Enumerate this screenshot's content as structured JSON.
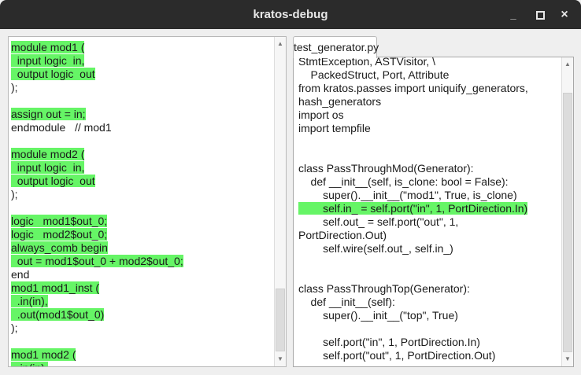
{
  "window": {
    "title": "kratos-debug",
    "minimize": "_",
    "maximize": "▫",
    "close": "×"
  },
  "colors": {
    "highlight": "#66f566",
    "titlebar": "#2b2b2b"
  },
  "left_panel": {
    "lines": [
      {
        "text": "module mod1 (",
        "hl": true
      },
      {
        "text": "  input logic  in,",
        "hl": true
      },
      {
        "text": "  output logic  out",
        "hl": true
      },
      {
        "text": ");",
        "hl": false
      },
      {
        "text": "",
        "hl": false
      },
      {
        "text": "assign out = in;",
        "hl": true
      },
      {
        "text": "endmodule   // mod1",
        "hl": false
      },
      {
        "text": "",
        "hl": false
      },
      {
        "text": "module mod2 (",
        "hl": true
      },
      {
        "text": "  input logic  in,",
        "hl": true
      },
      {
        "text": "  output logic  out",
        "hl": true
      },
      {
        "text": ");",
        "hl": false
      },
      {
        "text": "",
        "hl": false
      },
      {
        "text": "logic   mod1$out_0;",
        "hl": true
      },
      {
        "text": "logic   mod2$out_0;",
        "hl": true
      },
      {
        "text": "always_comb begin",
        "hl": true
      },
      {
        "text": "  out = mod1$out_0 + mod2$out_0;",
        "hl": true
      },
      {
        "text": "end",
        "hl": false
      },
      {
        "text": "mod1 mod1_inst (",
        "hl": true
      },
      {
        "text": "  .in(in),",
        "hl": true
      },
      {
        "text": "  .out(mod1$out_0)",
        "hl": true
      },
      {
        "text": ");",
        "hl": false
      },
      {
        "text": "",
        "hl": false
      },
      {
        "text": "mod1 mod2 (",
        "hl": true
      },
      {
        "text": "  .in(in),",
        "hl": true
      }
    ],
    "scroll_fraction": 0.9
  },
  "right_panel": {
    "tab_label": "test_generator.py",
    "lines": [
      {
        "text": "StmtException, ASTVisitor, \\",
        "hl": false
      },
      {
        "text": "    PackedStruct, Port, Attribute",
        "hl": false
      },
      {
        "text": "from kratos.passes import uniquify_generators,",
        "hl": false
      },
      {
        "text": "hash_generators",
        "hl": false
      },
      {
        "text": "import os",
        "hl": false
      },
      {
        "text": "import tempfile",
        "hl": false
      },
      {
        "text": "",
        "hl": false
      },
      {
        "text": "",
        "hl": false
      },
      {
        "text": "class PassThroughMod(Generator):",
        "hl": false
      },
      {
        "text": "    def __init__(self, is_clone: bool = False):",
        "hl": false
      },
      {
        "text": "        super().__init__(\"mod1\", True, is_clone)",
        "hl": false
      },
      {
        "text": "        self.in_ = self.port(\"in\", 1, PortDirection.In)",
        "hl": true
      },
      {
        "text": "        self.out_ = self.port(\"out\", 1,",
        "hl": false
      },
      {
        "text": "PortDirection.Out)",
        "hl": false
      },
      {
        "text": "        self.wire(self.out_, self.in_)",
        "hl": false
      },
      {
        "text": "",
        "hl": false
      },
      {
        "text": "",
        "hl": false
      },
      {
        "text": "class PassThroughTop(Generator):",
        "hl": false
      },
      {
        "text": "    def __init__(self):",
        "hl": false
      },
      {
        "text": "        super().__init__(\"top\", True)",
        "hl": false
      },
      {
        "text": "",
        "hl": false
      },
      {
        "text": "        self.port(\"in\", 1, PortDirection.In)",
        "hl": false
      },
      {
        "text": "        self.port(\"out\", 1, PortDirection.Out)",
        "hl": false
      }
    ],
    "scroll_fraction": 1.0
  }
}
